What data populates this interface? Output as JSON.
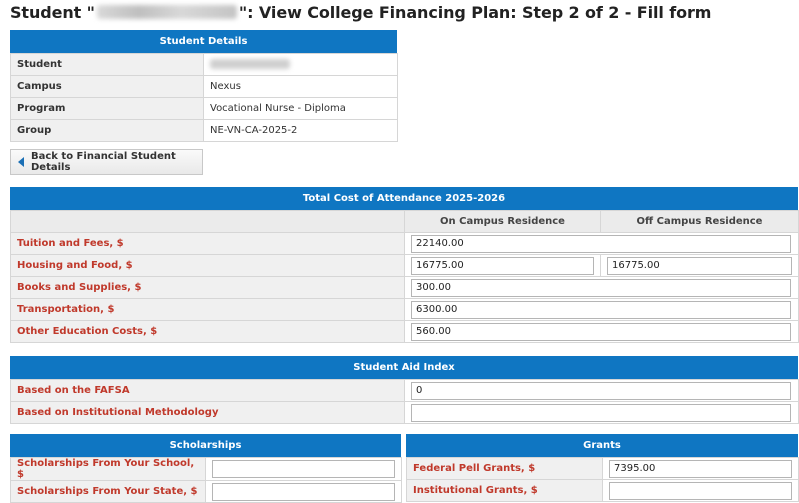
{
  "title": {
    "prefix": "Student \"",
    "suffix": "\": View College Financing Plan: Step 2 of 2 - Fill form"
  },
  "student_details": {
    "header": "Student Details",
    "rows": [
      {
        "label": "Student",
        "value": ""
      },
      {
        "label": "Campus",
        "value": "Nexus"
      },
      {
        "label": "Program",
        "value": "Vocational Nurse - Diploma"
      },
      {
        "label": "Group",
        "value": "NE-VN-CA-2025-2"
      }
    ]
  },
  "back_button": {
    "label": "Back to Financial Student Details",
    "icon": "arrow-left-icon"
  },
  "cost": {
    "header": "Total Cost of Attendance 2025-2026",
    "col_on": "On Campus Residence",
    "col_off": "Off Campus Residence",
    "tuition": {
      "label": "Tuition and Fees, $",
      "value": "22140.00"
    },
    "housing": {
      "label": "Housing and Food, $",
      "on": "16775.00",
      "off": "16775.00"
    },
    "books": {
      "label": "Books and Supplies, $",
      "value": "300.00"
    },
    "transport": {
      "label": "Transportation, $",
      "value": "6300.00"
    },
    "other": {
      "label": "Other Education Costs, $",
      "value": "560.00"
    }
  },
  "sai": {
    "header": "Student Aid Index",
    "fafsa": {
      "label": "Based on the FAFSA",
      "value": "0"
    },
    "inst": {
      "label": "Based on Institutional Methodology",
      "value": ""
    }
  },
  "scholarships": {
    "header": "Scholarships",
    "school": {
      "label": "Scholarships From Your School, $",
      "value": ""
    },
    "state": {
      "label": "Scholarships From Your State, $",
      "value": ""
    }
  },
  "grants": {
    "header": "Grants",
    "pell": {
      "label": "Federal Pell Grants, $",
      "value": "7395.00"
    },
    "inst": {
      "label": "Institutional Grants, $",
      "value": ""
    }
  },
  "colors": {
    "header_bg": "#0f76c2",
    "label_red": "#c0392b",
    "label_bg": "#f0f0f0"
  }
}
